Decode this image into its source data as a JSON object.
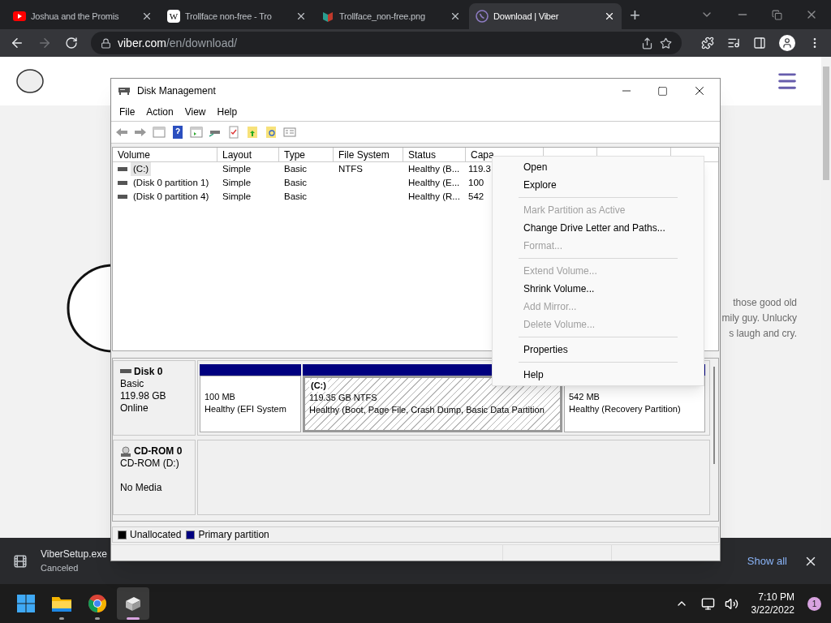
{
  "browser": {
    "tabs": [
      {
        "title": "Joshua and the Promis",
        "kind": "video",
        "selected": false
      },
      {
        "title": "Trollface non-free - Tro",
        "kind": "letter",
        "letter": "W",
        "selected": false
      },
      {
        "title": "Trollface_non-free.png",
        "kind": "image",
        "selected": false
      },
      {
        "title": "Download | Viber",
        "kind": "phone",
        "selected": true
      }
    ],
    "new_tab": "+",
    "url_host": "viber.com",
    "url_path": "/en/download/",
    "forward_disabled": true
  },
  "page": {
    "paragraph_lines": [
      "those good old",
      "mily guy. Unlucky",
      "s laugh and cry."
    ]
  },
  "disk_management": {
    "title": "Disk Management",
    "menu": [
      "File",
      "Action",
      "View",
      "Help"
    ],
    "columns": [
      "Volume",
      "Layout",
      "Type",
      "File System",
      "Status",
      "Capa"
    ],
    "rows": [
      {
        "cells": [
          "(C:)",
          "Simple",
          "Basic",
          "NTFS",
          "Healthy (B...",
          "119.3"
        ],
        "selected": true
      },
      {
        "cells": [
          "(Disk 0 partition 1)",
          "Simple",
          "Basic",
          "",
          "Healthy (E...",
          "100"
        ],
        "selected": false
      },
      {
        "cells": [
          "(Disk 0 partition 4)",
          "Simple",
          "Basic",
          "",
          "Healthy (R...",
          "542"
        ],
        "selected": false
      }
    ],
    "disks": [
      {
        "kind": "disk",
        "name": "Disk 0",
        "lines": [
          "Basic",
          "119.98 GB",
          "Online"
        ],
        "partitions": [
          {
            "size": "100 MB",
            "description": "Healthy (EFI System",
            "selected": false
          },
          {
            "label": "(C:)",
            "size": "119.35 GB NTFS",
            "description": "Healthy (Boot, Page File, Crash Dump, Basic Data Partition",
            "selected": true
          },
          {
            "size": "542 MB",
            "description": "Healthy (Recovery Partition)",
            "selected": false
          }
        ]
      },
      {
        "kind": "cdrom",
        "name": "CD-ROM 0",
        "lines": [
          "CD-ROM (D:)",
          "No Media"
        ]
      }
    ],
    "legend": [
      {
        "label": "Unallocated",
        "color": "#000000"
      },
      {
        "label": "Primary partition",
        "color": "#00007f"
      }
    ]
  },
  "context_menu": {
    "items": [
      {
        "kind": "item",
        "label": "Open",
        "disabled": false
      },
      {
        "kind": "item",
        "label": "Explore",
        "disabled": false
      },
      {
        "kind": "separator"
      },
      {
        "kind": "item",
        "label": "Mark Partition as Active",
        "disabled": true
      },
      {
        "kind": "item",
        "label": "Change Drive Letter and Paths...",
        "disabled": false
      },
      {
        "kind": "item",
        "label": "Format...",
        "disabled": true
      },
      {
        "kind": "separator"
      },
      {
        "kind": "item",
        "label": "Extend Volume...",
        "disabled": true
      },
      {
        "kind": "item",
        "label": "Shrink Volume...",
        "disabled": false
      },
      {
        "kind": "item",
        "label": "Add Mirror...",
        "disabled": true
      },
      {
        "kind": "item",
        "label": "Delete Volume...",
        "disabled": true
      },
      {
        "kind": "separator"
      },
      {
        "kind": "item",
        "label": "Properties",
        "disabled": false
      },
      {
        "kind": "separator"
      },
      {
        "kind": "item",
        "label": "Help",
        "disabled": false
      }
    ]
  },
  "download_bar": {
    "file": "ViberSetup.exe",
    "status": "Canceled",
    "show_all": "Show all"
  },
  "taskbar": {
    "apps": [
      {
        "kind": "start",
        "active": false
      },
      {
        "kind": "folder",
        "active": false
      },
      {
        "kind": "browser",
        "active": false
      },
      {
        "kind": "disk",
        "active": true
      }
    ],
    "time": "7:10 PM",
    "date": "3/22/2022",
    "notification_count": "1"
  }
}
